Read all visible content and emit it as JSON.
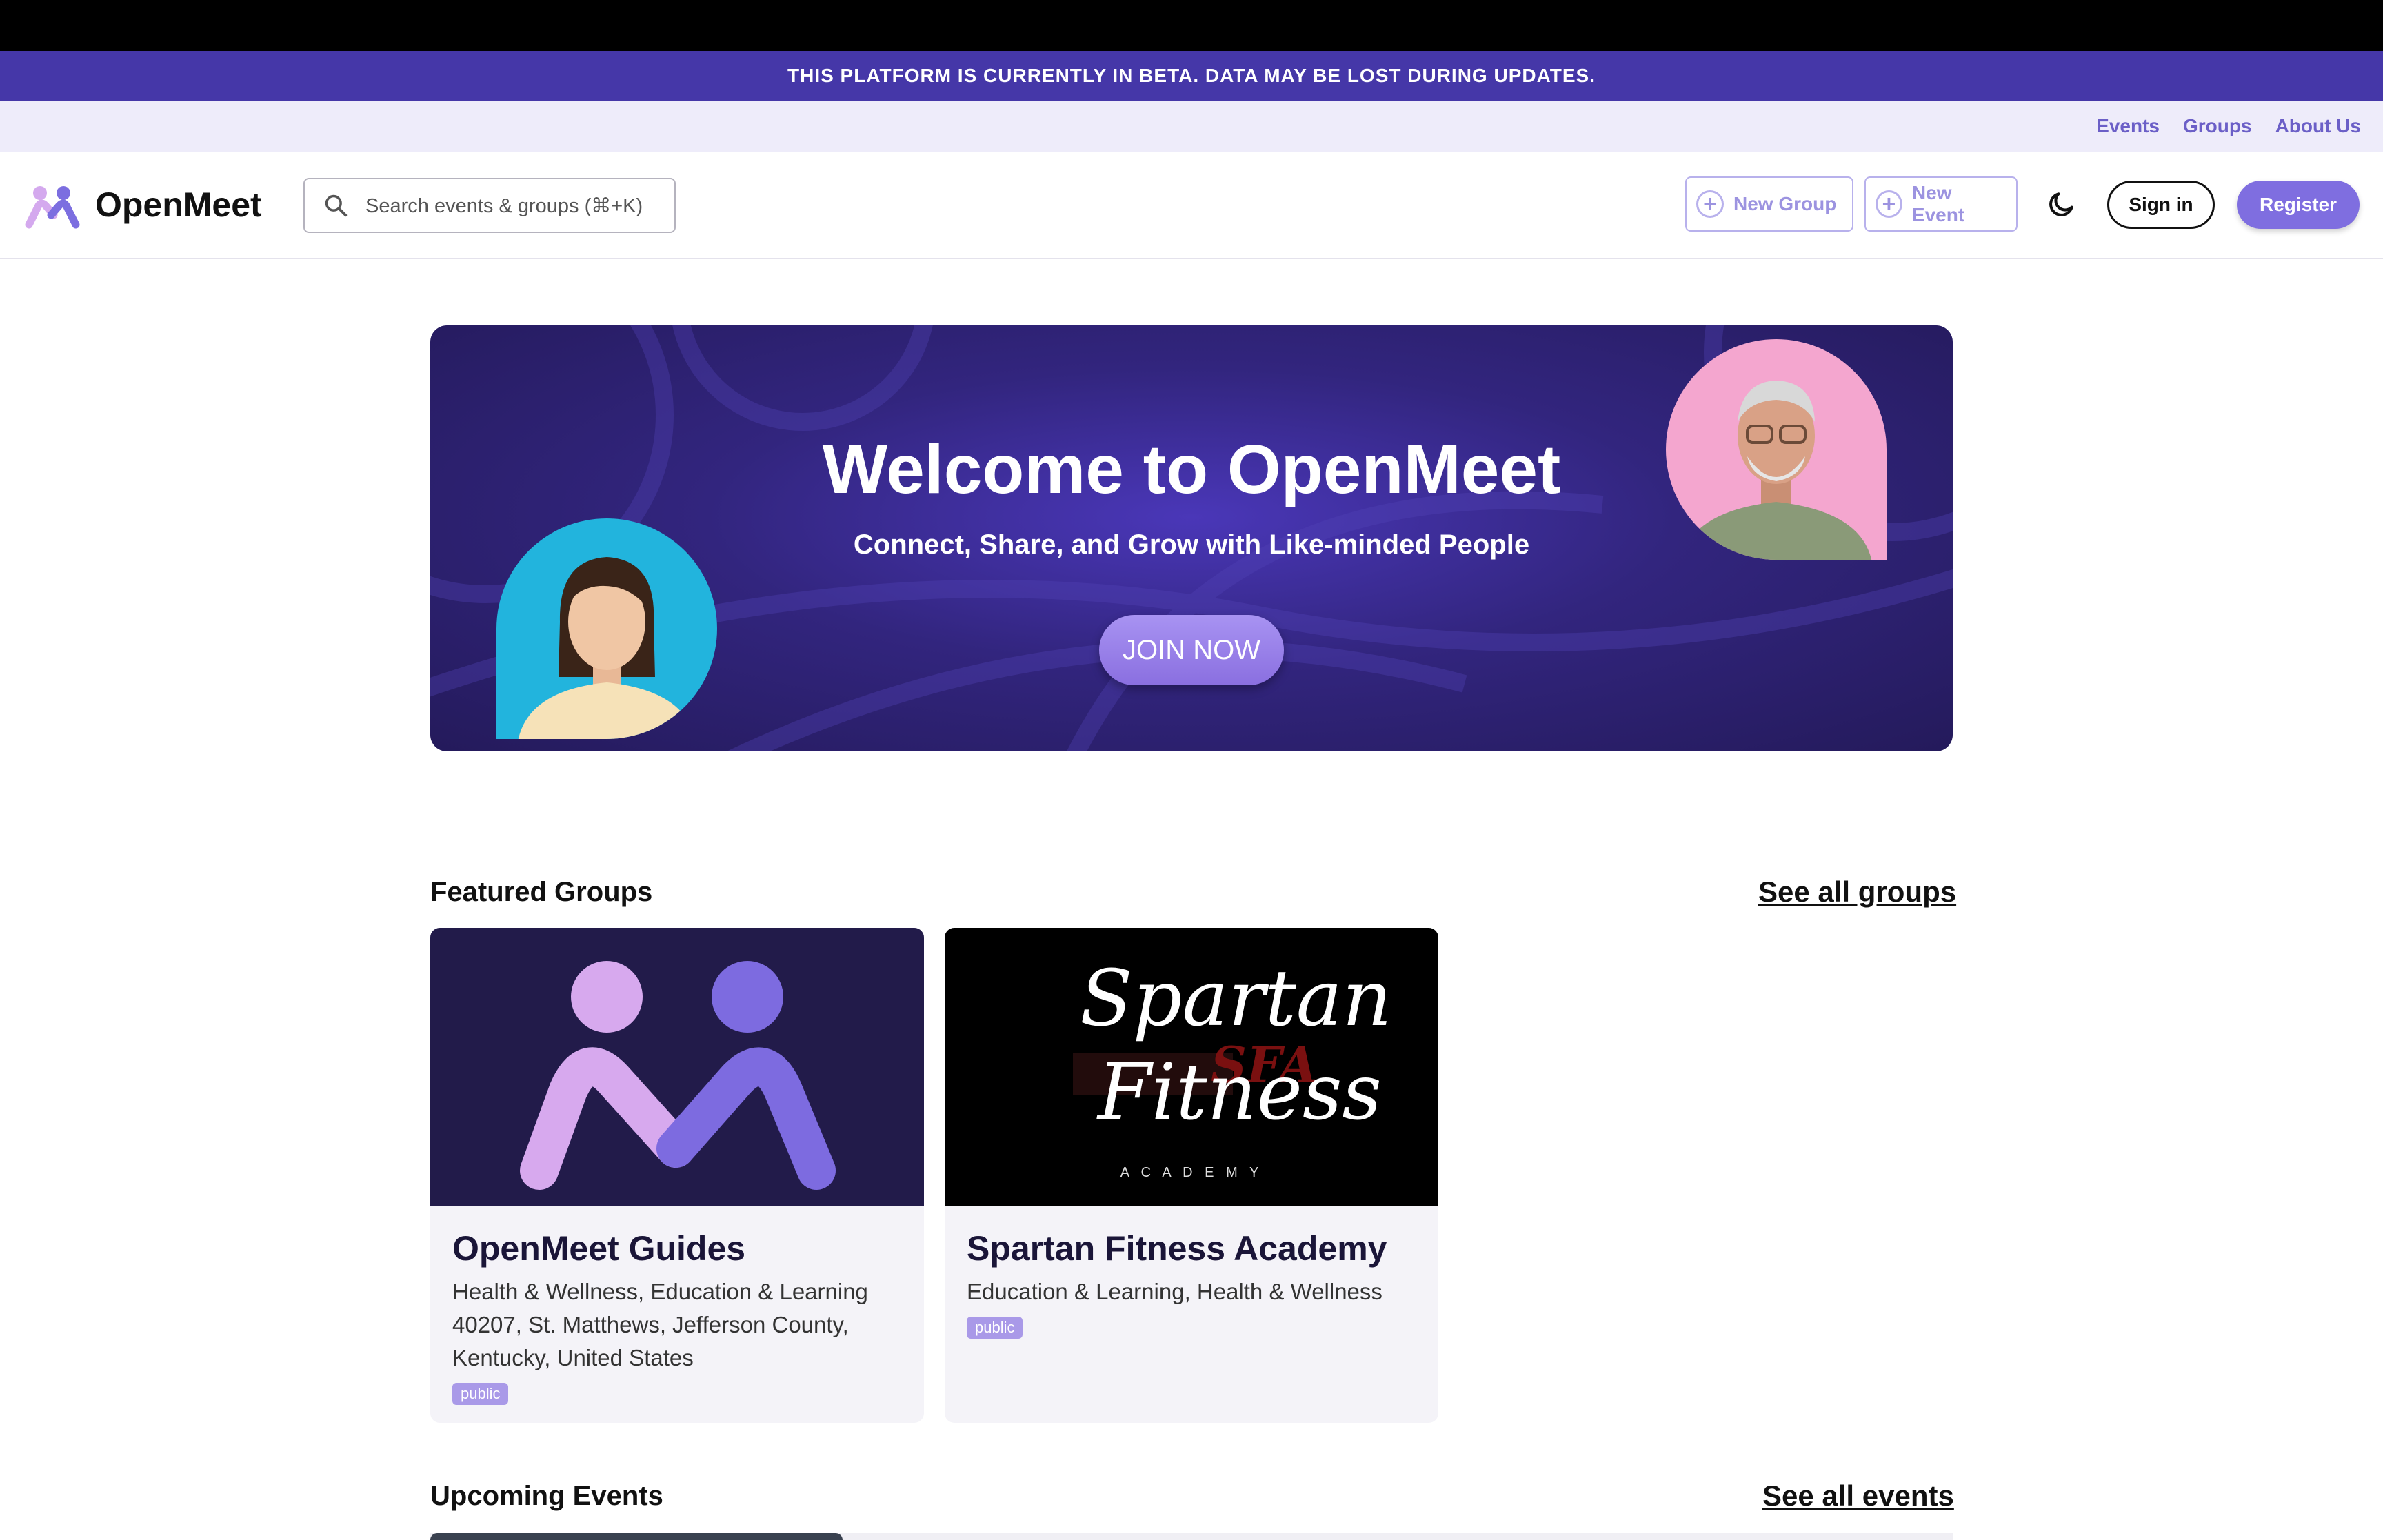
{
  "banner": {
    "text": "THIS PLATFORM IS CURRENTLY IN BETA. DATA MAY BE LOST DURING UPDATES."
  },
  "subnav": {
    "items": [
      "Events",
      "Groups",
      "About Us"
    ]
  },
  "header": {
    "brand": "OpenMeet",
    "search_placeholder": "Search events & groups (⌘+K)",
    "new_group": "New Group",
    "new_event": "New Event",
    "sign_in": "Sign in",
    "register": "Register"
  },
  "hero": {
    "title": "Welcome to OpenMeet",
    "subtitle": "Connect, Share, and Grow with Like-minded People",
    "cta": "JOIN NOW"
  },
  "featured_groups": {
    "title": "Featured Groups",
    "see_all": "See all groups",
    "groups": [
      {
        "name": "OpenMeet Guides",
        "categories": "Health & Wellness, Education & Learning",
        "location": "40207, St. Matthews, Jefferson County, Kentucky, United States",
        "badge": "public"
      },
      {
        "name": "Spartan Fitness Academy",
        "categories": "Education & Learning, Health & Wellness",
        "badge": "public",
        "image_text": {
          "line1": "Spartan",
          "line2": "Fitness",
          "tag": "SFA",
          "footer": "A C A D E M Y"
        }
      }
    ]
  },
  "upcoming_events": {
    "title": "Upcoming Events",
    "see_all": "See all events"
  },
  "colors": {
    "primary": "#4537a8",
    "accent": "#7f6ee0",
    "hero_bg": "#2f2478"
  }
}
